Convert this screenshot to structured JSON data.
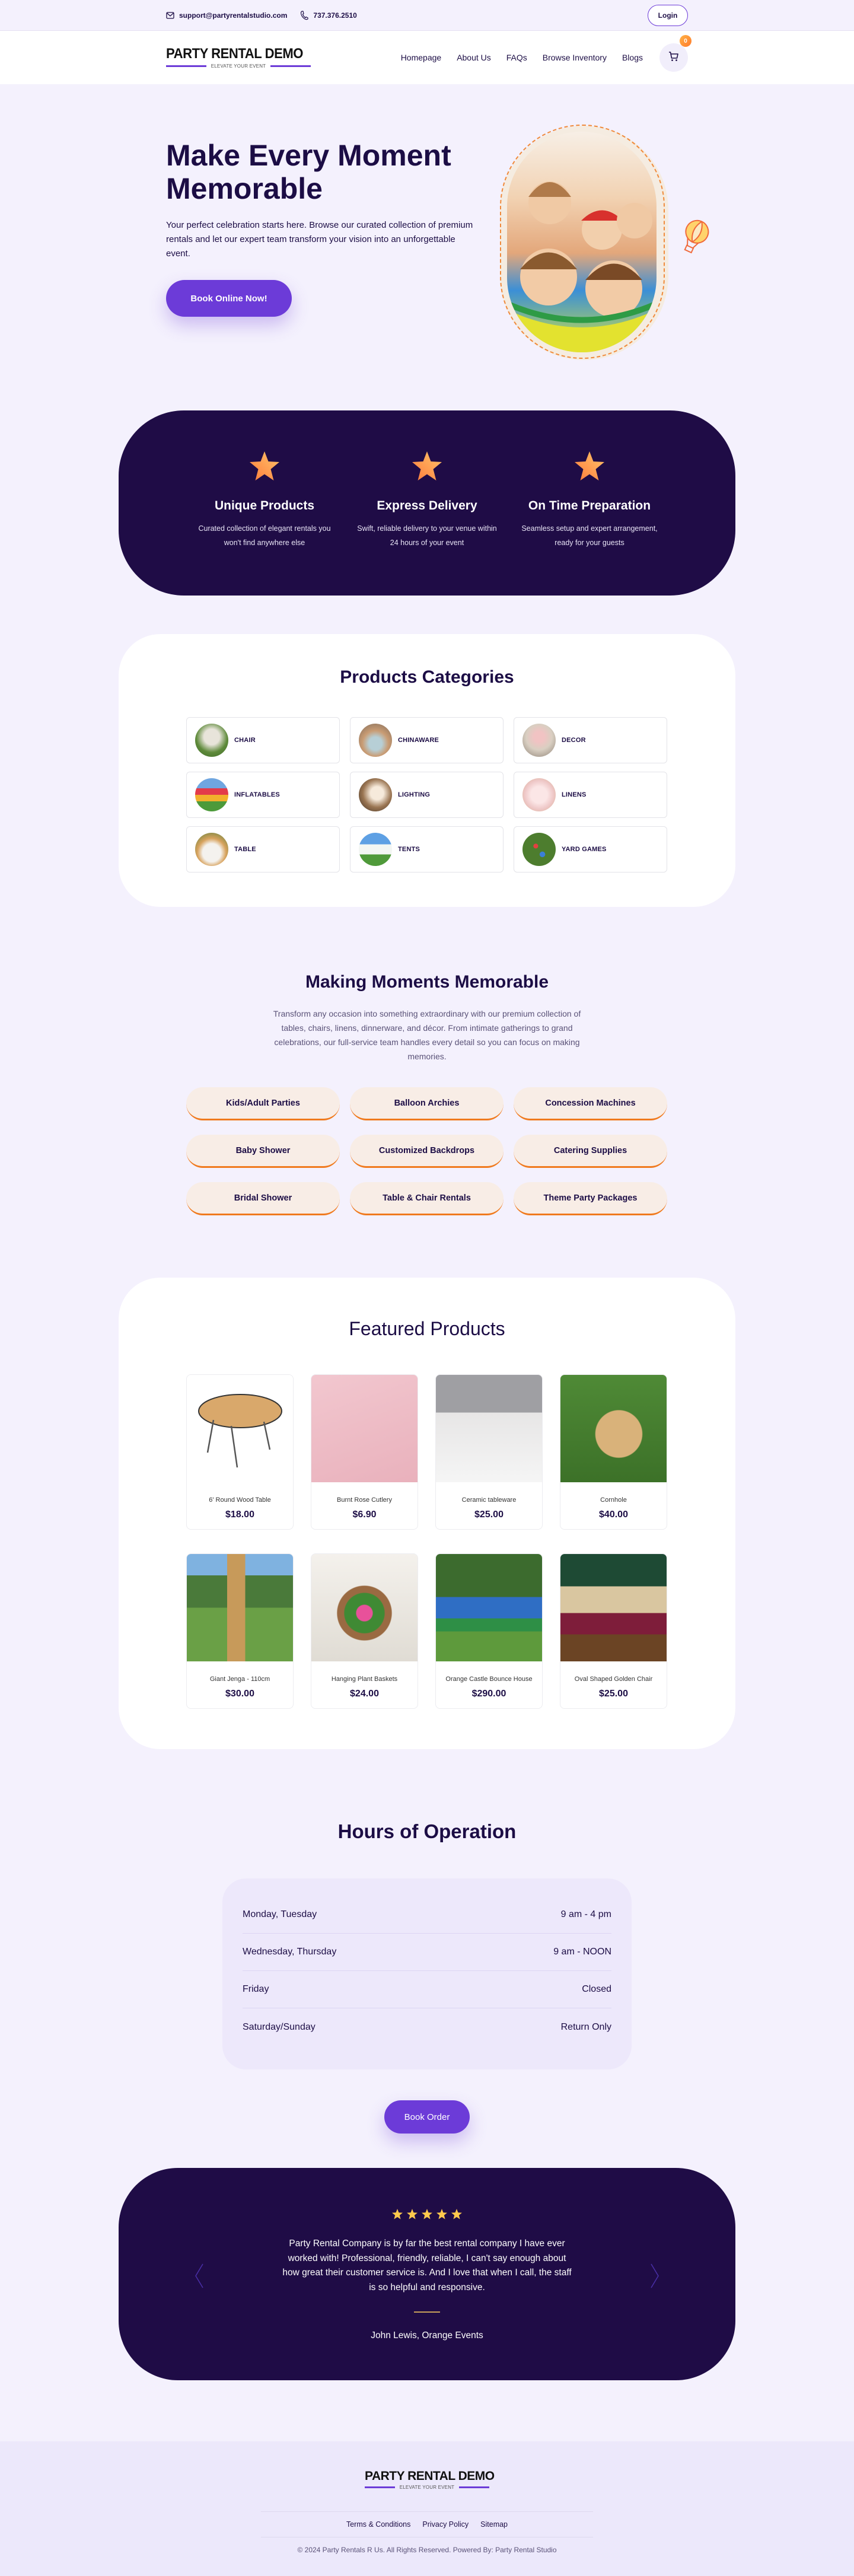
{
  "topbar": {
    "email": "support@partyrentalstudio.com",
    "phone": "737.376.2510",
    "login_label": "Login"
  },
  "header": {
    "logo_title": "PARTY RENTAL DEMO",
    "logo_tagline": "ELEVATE YOUR EVENT",
    "nav": [
      "Homepage",
      "About Us",
      "FAQs",
      "Browse Inventory",
      "Blogs"
    ],
    "cart_count": "0"
  },
  "hero": {
    "title": "Make Every Moment Memorable",
    "text": "Your perfect celebration starts here. Browse our curated collection of premium rentals and let our expert team transform your vision into an unforgettable event.",
    "cta_label": "Book Online Now!"
  },
  "features": [
    {
      "title": "Unique Products",
      "text": "Curated collection of elegant rentals you won't find anywhere else"
    },
    {
      "title": "Express Delivery",
      "text": "Swift, reliable delivery to your venue within 24 hours of your event"
    },
    {
      "title": "On Time Preparation",
      "text": "Seamless setup and expert arrangement, ready for your guests"
    }
  ],
  "categories": {
    "title": "Products Categories",
    "items": [
      "CHAIR",
      "CHINAWARE",
      "DECOR",
      "INFLATABLES",
      "LIGHTING",
      "LINENS",
      "TABLE",
      "TENTS",
      "YARD GAMES"
    ]
  },
  "moments": {
    "title": "Making Moments Memorable",
    "text": "Transform any occasion into something extraordinary with our premium collection of tables, chairs, linens, dinnerware, and décor. From intimate gatherings to grand celebrations, our full-service team handles every detail so you can focus on making memories.",
    "services": [
      "Kids/Adult Parties",
      "Balloon Archies",
      "Concession Machines",
      "Baby Shower",
      "Customized Backdrops",
      "Catering Supplies",
      "Bridal Shower",
      "Table & Chair Rentals",
      "Theme Party Packages"
    ]
  },
  "featured": {
    "title": "Featured Products",
    "products": [
      {
        "name": "6' Round Wood Table",
        "price": "$18.00"
      },
      {
        "name": "Burnt Rose Cutlery",
        "price": "$6.90"
      },
      {
        "name": "Ceramic tableware",
        "price": "$25.00"
      },
      {
        "name": "Cornhole",
        "price": "$40.00"
      },
      {
        "name": "Giant Jenga - 110cm",
        "price": "$30.00"
      },
      {
        "name": "Hanging Plant Baskets",
        "price": "$24.00"
      },
      {
        "name": "Orange Castle Bounce House",
        "price": "$290.00"
      },
      {
        "name": "Oval Shaped Golden Chair",
        "price": "$25.00"
      }
    ]
  },
  "hours": {
    "title": "Hours of Operation",
    "rows": [
      {
        "day": "Monday, Tuesday",
        "time": "9 am - 4 pm"
      },
      {
        "day": "Wednesday, Thursday",
        "time": "9 am - NOON"
      },
      {
        "day": "Friday",
        "time": "Closed"
      },
      {
        "day": "Saturday/Sunday",
        "time": "Return Only"
      }
    ],
    "cta_label": "Book Order"
  },
  "testimonial": {
    "rating": 5,
    "quote": "Party Rental Company is by far the best rental company I have ever worked with! Professional, friendly, reliable, I can't say enough about how great their customer service is. And I love that when I call, the staff is so helpful and responsive.",
    "author": "John Lewis, Orange Events"
  },
  "footer": {
    "logo_title": "PARTY RENTAL DEMO",
    "logo_tagline": "ELEVATE YOUR EVENT",
    "links": [
      "Terms & Conditions",
      "Privacy Policy",
      "Sitemap"
    ],
    "copyright": "© 2024 Party Rentals R Us. All Rights Reserved. Powered By: Party Rental Studio"
  },
  "colors": {
    "primary": "#6c3bd8",
    "dark": "#1f0c46",
    "accent_orange": "#f07a1e",
    "background": "#f4f1fd"
  }
}
